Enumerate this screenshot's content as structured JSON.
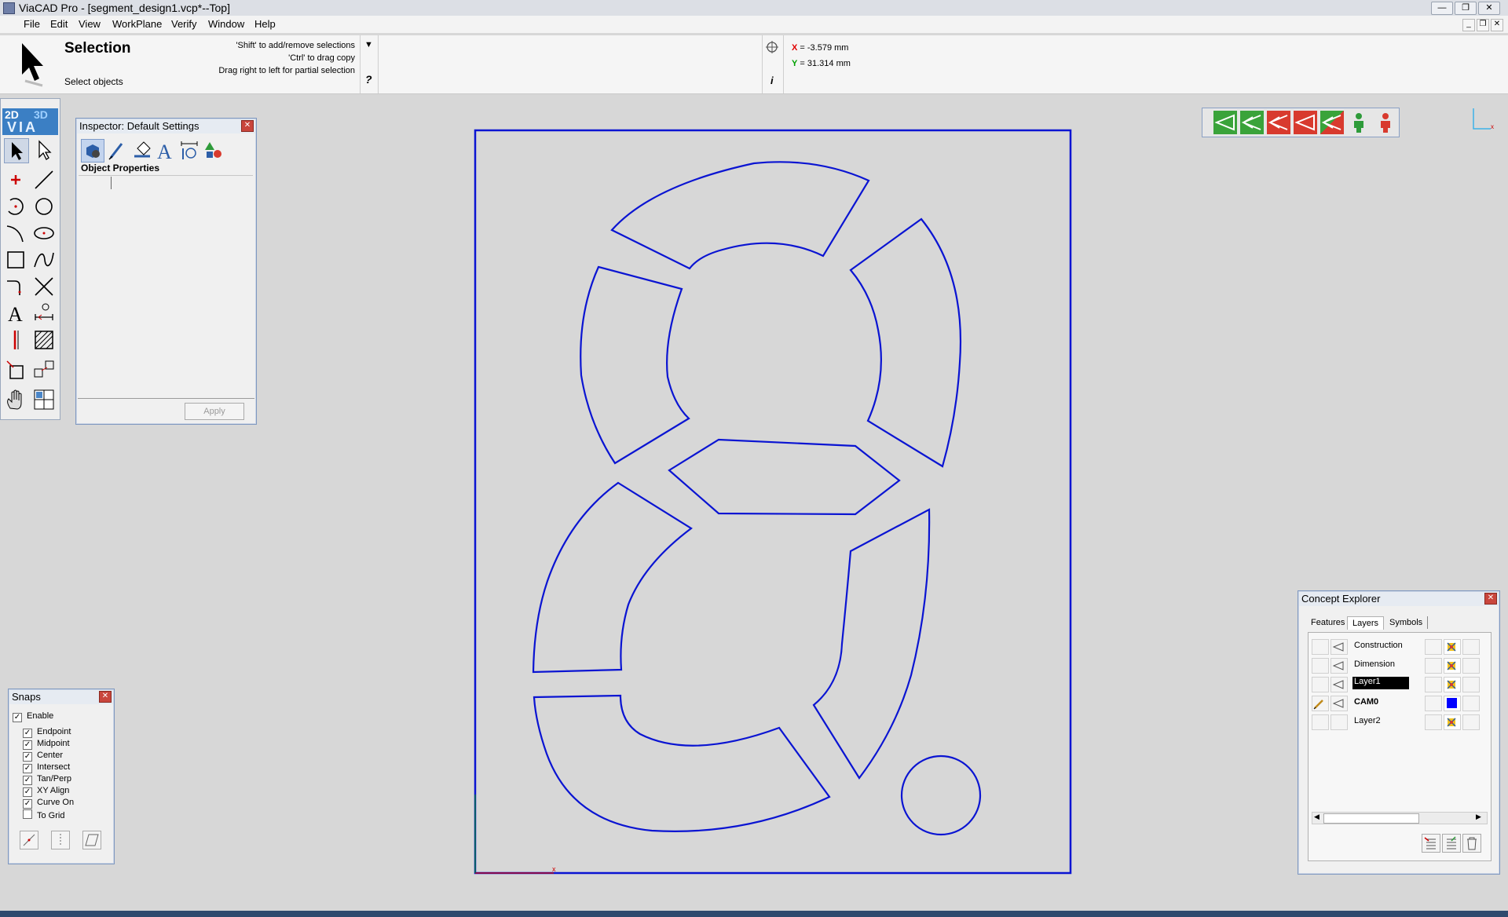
{
  "window": {
    "title": "ViaCAD Pro - [segment_design1.vcp*--Top]",
    "controls": [
      "—",
      "❐",
      "✕"
    ]
  },
  "menu": [
    "File",
    "Edit",
    "View",
    "WorkPlane",
    "Verify",
    "Window",
    "Help"
  ],
  "context": {
    "tool_name": "Selection",
    "tool_desc": "Select objects",
    "hints": [
      "'Shift' to add/remove selections",
      "'Ctrl' to drag copy",
      "Drag right to left for partial selection"
    ],
    "help_mark": "?",
    "info_mark": "i",
    "x_label": "X",
    "x_value": "= -3.579 mm",
    "y_label": "Y",
    "y_value": "= 31.314 mm"
  },
  "palette": {
    "logo_2d": "2D",
    "logo_3d": "3D",
    "logo_via": "VIA"
  },
  "inspector": {
    "title": "Inspector: Default Settings",
    "section": "Object Properties",
    "apply_label": "Apply"
  },
  "snaps": {
    "title": "Snaps",
    "enable_label": "Enable",
    "items": [
      {
        "label": "Endpoint",
        "checked": true
      },
      {
        "label": "Midpoint",
        "checked": true
      },
      {
        "label": "Center",
        "checked": true
      },
      {
        "label": "Intersect",
        "checked": true
      },
      {
        "label": "Tan/Perp",
        "checked": true
      },
      {
        "label": "XY Align",
        "checked": true
      },
      {
        "label": "Curve On",
        "checked": true
      },
      {
        "label": "To Grid",
        "checked": false
      }
    ]
  },
  "explorer": {
    "title": "Concept Explorer",
    "tabs": [
      "Features",
      "Layers",
      "Symbols"
    ],
    "active_tab": "Layers",
    "layers": [
      {
        "name": "Construction",
        "active": false,
        "bold": false,
        "color": "pattern"
      },
      {
        "name": "Dimension",
        "active": false,
        "bold": false,
        "color": "pattern"
      },
      {
        "name": "Layer1",
        "active": true,
        "bold": false,
        "color": "pattern"
      },
      {
        "name": "CAM0",
        "active": false,
        "bold": true,
        "color": "#0000ff"
      },
      {
        "name": "Layer2",
        "active": false,
        "bold": false,
        "color": "pattern"
      }
    ]
  },
  "colors": {
    "drawing_stroke": "#0a14d2",
    "toolbar_green": "#3aa33a",
    "toolbar_red": "#d83a2e"
  }
}
